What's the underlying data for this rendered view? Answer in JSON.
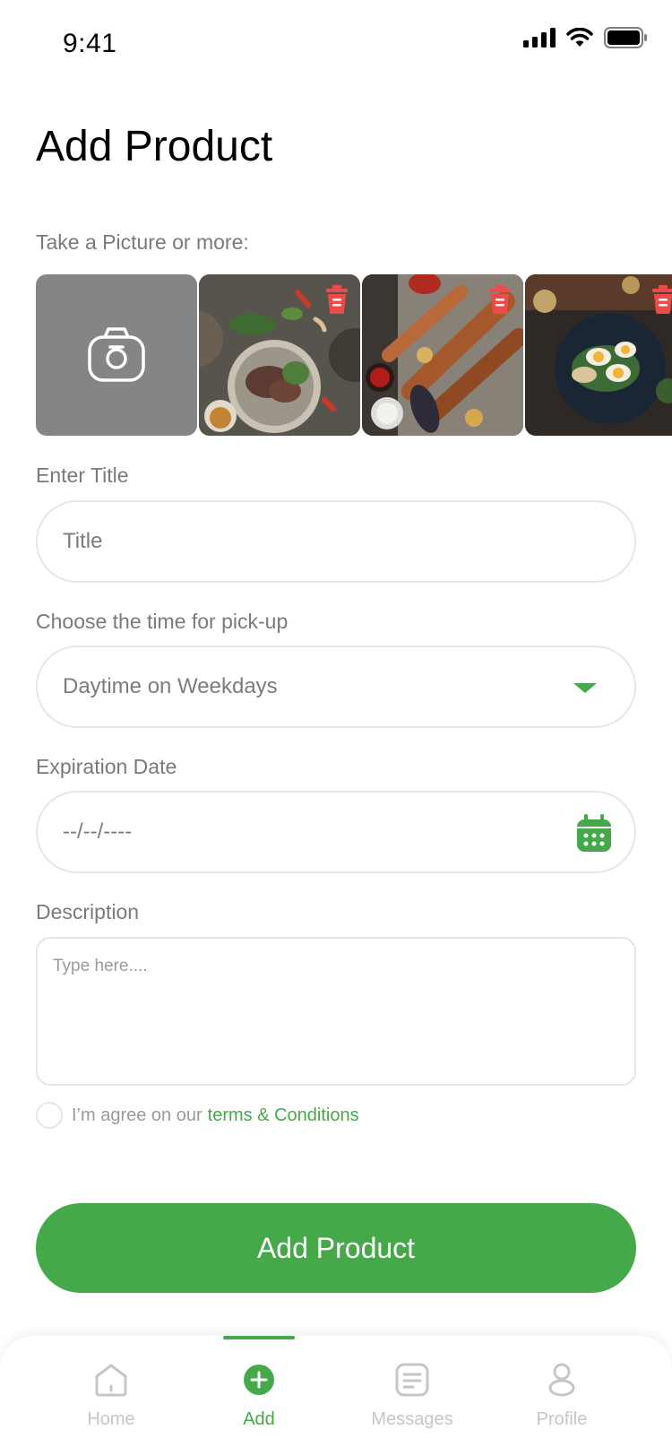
{
  "status_bar": {
    "time": "9:41"
  },
  "page": {
    "title": "Add Product"
  },
  "photos": {
    "label": "Take a Picture or more:",
    "items": [
      {
        "icon": "camera-icon"
      },
      {
        "image": "food-photo-salad",
        "delete_icon": "trash-icon"
      },
      {
        "image": "food-photo-skewers",
        "delete_icon": "trash-icon"
      },
      {
        "image": "food-photo-eggs",
        "delete_icon": "trash-icon"
      }
    ]
  },
  "title_field": {
    "label": "Enter Title",
    "placeholder": "Title"
  },
  "pickup_field": {
    "label": "Choose the time for pick-up",
    "value": "Daytime on Weekdays",
    "icon": "chevron-down-icon"
  },
  "expiration_field": {
    "label": "Expiration Date",
    "placeholder": "--/--/----",
    "icon": "calendar-icon"
  },
  "description_field": {
    "label": "Description",
    "placeholder": "Type here...."
  },
  "terms": {
    "text": "I’m agree on our",
    "link": "terms & Conditions"
  },
  "primary_button": {
    "label": "Add Product"
  },
  "tabbar": {
    "active": "Add",
    "tabs": [
      {
        "label": "Home",
        "icon": "home-icon"
      },
      {
        "label": "Add",
        "icon": "plus-circle-icon"
      },
      {
        "label": "Messages",
        "icon": "message-icon"
      },
      {
        "label": "Profile",
        "icon": "profile-icon"
      }
    ]
  },
  "colors": {
    "accent": "#45a94a",
    "delete": "#ef4a4a",
    "camera_tile": "#858585",
    "border": "#e6e6e6"
  }
}
